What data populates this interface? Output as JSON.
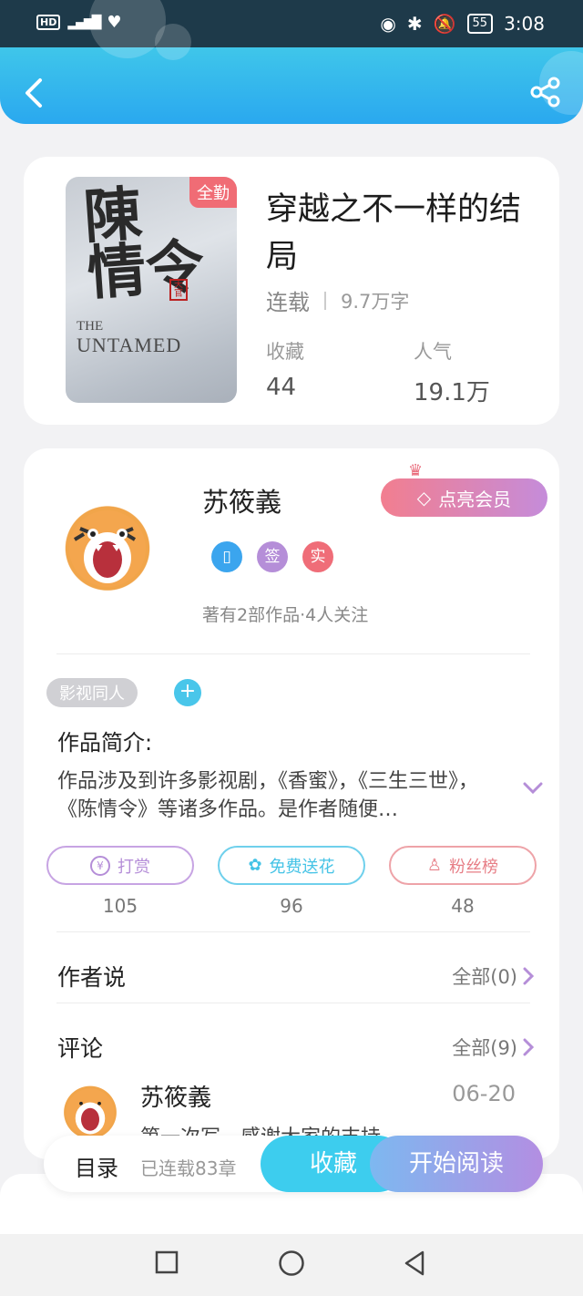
{
  "status_bar": {
    "hd": "HD",
    "network": "4G",
    "battery": "55",
    "time": "3:08"
  },
  "book": {
    "badge": "全勤",
    "cover_title_small": "THE",
    "cover_title": "UNTAMED",
    "title": "穿越之不一样的结局",
    "status": "连载",
    "words": "9.7万字",
    "favorites_label": "收藏",
    "favorites_value": "44",
    "popularity_label": "人气",
    "popularity_value": "19.1万"
  },
  "author": {
    "name": "苏筱義",
    "vip_label": "点亮会员",
    "badges": [
      "签",
      "实"
    ],
    "stats": "著有2部作品·4人关注"
  },
  "tag": "影视同人",
  "intro": {
    "title": "作品简介:",
    "text": "作品涉及到许多影视剧，《香蜜》，《三生三世》，《陈情令》等诸多作品。是作者随便…"
  },
  "actions": [
    {
      "label": "打赏",
      "count": "105"
    },
    {
      "label": "免费送花",
      "count": "96"
    },
    {
      "label": "粉丝榜",
      "count": "48"
    }
  ],
  "author_says": {
    "title": "作者说",
    "link": "全部(0)"
  },
  "comments": {
    "title": "评论",
    "link": "全部(9)",
    "first": {
      "name": "苏筱義",
      "date": "06-20",
      "text": "第一次写，感谢大家的支持"
    }
  },
  "bottom_bar": {
    "catalog": "目录",
    "chapters": "已连载83章",
    "favorite": "收藏",
    "read": "开始阅读"
  },
  "colors": {
    "header": "#2aa8ef",
    "accent": "#3dcdee",
    "vip": "#f27e8f",
    "reward": "#b58ed8",
    "flower": "#45c3e6",
    "fans": "#e77e86"
  }
}
